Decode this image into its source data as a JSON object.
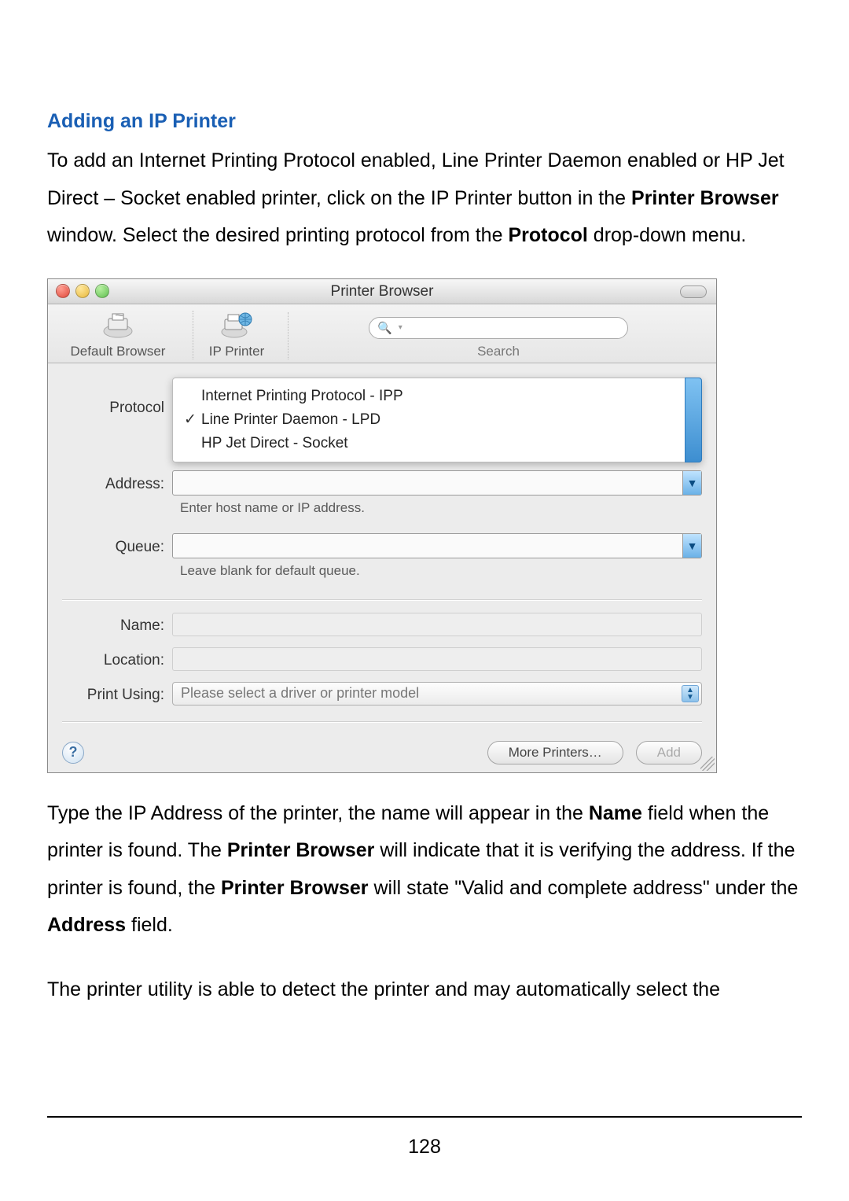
{
  "heading": "Adding an IP Printer",
  "para1_a": "To add an Internet Printing Protocol enabled, Line Printer Daemon enabled or HP Jet Direct – Socket enabled printer, click on the IP Printer button in the ",
  "para1_bold1": "Printer Browser",
  "para1_b": " window. Select the desired printing protocol from the ",
  "para1_bold2": "Protocol",
  "para1_c": " drop-down menu.",
  "pb": {
    "title": "Printer Browser",
    "toolbar": {
      "default_browser": "Default Browser",
      "ip_printer": "IP Printer",
      "search_label": "Search"
    },
    "labels": {
      "protocol": "Protocol",
      "address": "Address:",
      "queue": "Queue:",
      "name": "Name:",
      "location": "Location:",
      "print_using": "Print Using:"
    },
    "protocol_options": [
      "Internet Printing Protocol - IPP",
      "Line Printer Daemon - LPD",
      "HP Jet Direct - Socket"
    ],
    "protocol_selected_index": 1,
    "hints": {
      "address": "Enter host name or IP address.",
      "queue": "Leave blank for default queue."
    },
    "print_using_placeholder": "Please select a driver or printer model",
    "buttons": {
      "more_printers": "More Printers…",
      "add": "Add"
    }
  },
  "para2_a": "Type the IP Address of the printer, the name will appear in the ",
  "para2_bold1": "Name",
  "para2_b": " field when the printer is found. The ",
  "para2_bold2": "Printer Browser",
  "para2_c": " will indicate that it is verifying the address. If the printer is found, the ",
  "para2_bold3": "Printer Browser",
  "para2_d": " will state \"Valid and complete address\" under the ",
  "para2_bold4": "Address",
  "para2_e": " field.",
  "para3": "The printer utility is able to detect the printer and may automatically select the",
  "page_number": "128"
}
